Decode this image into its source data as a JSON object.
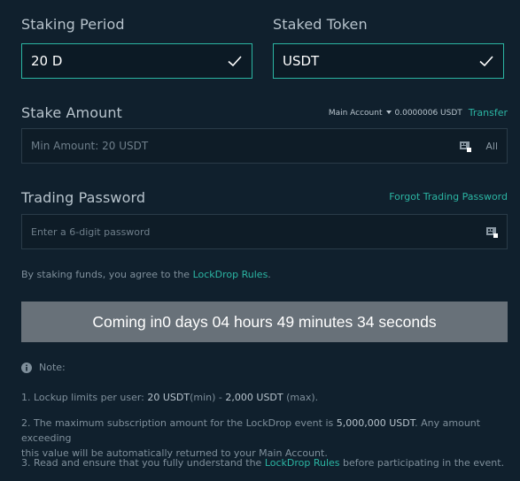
{
  "staking_period": {
    "label": "Staking Period",
    "value": "20 D"
  },
  "staked_token": {
    "label": "Staked Token",
    "value": "USDT"
  },
  "stake_amount": {
    "label": "Stake Amount",
    "account_label": "Main Account",
    "balance": "0.0000006 USDT",
    "transfer_label": "Transfer",
    "placeholder": "Min Amount: 20 USDT",
    "all_label": "All"
  },
  "trading_password": {
    "label": "Trading Password",
    "forgot_label": "Forgot Trading Password",
    "placeholder": "Enter a 6-digit password"
  },
  "agreement": {
    "prefix": "By staking funds, you agree to the ",
    "link": "LockDrop Rules",
    "suffix": "."
  },
  "button": {
    "label": "Coming in0 days 04 hours 49 minutes 34 seconds"
  },
  "notes": {
    "title": "Note:",
    "item1": {
      "prefix": "1. Lockup limits per user: ",
      "min": "20 USDT",
      "min_suffix": "(min) - ",
      "max": "2,000 USDT",
      "max_suffix": " (max)."
    },
    "item2": {
      "prefix": "2. The maximum subscription amount for the LockDrop event is ",
      "amount": "5,000,000 USDT",
      "suffix_line1": ". Any amount exceeding",
      "line2": "this value will be automatically returned to your Main Account."
    },
    "item3": {
      "prefix": "3. Read and ensure that you fully understand the ",
      "link": "LockDrop Rules",
      "suffix": " before participating in the event."
    }
  },
  "colors": {
    "accent": "#2bb5a3",
    "background": "#10202d",
    "button": "#687179"
  }
}
